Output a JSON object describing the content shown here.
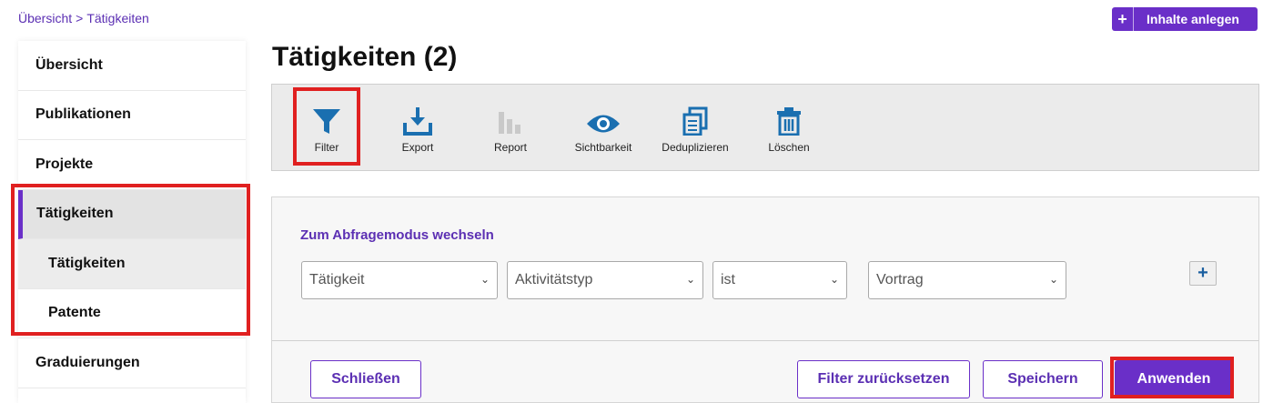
{
  "breadcrumb": {
    "home": "Übersicht",
    "separator": ">",
    "current": "Tätigkeiten"
  },
  "header": {
    "create_label": "Inhalte anlegen",
    "create_plus": "+"
  },
  "sidebar": {
    "items": [
      {
        "label": "Übersicht"
      },
      {
        "label": "Publikationen"
      },
      {
        "label": "Projekte"
      },
      {
        "label": "Tätigkeiten"
      },
      {
        "label": "Tätigkeiten"
      },
      {
        "label": "Patente"
      },
      {
        "label": "Graduierungen"
      }
    ]
  },
  "page": {
    "title": "Tätigkeiten (2)"
  },
  "toolbar": {
    "filter": "Filter",
    "export": "Export",
    "report": "Report",
    "visibility": "Sichtbarkeit",
    "dedupe": "Deduplizieren",
    "delete": "Löschen"
  },
  "filter_panel": {
    "switch_mode": "Zum Abfragemodus wechseln",
    "field1": "Tätigkeit",
    "field2": "Aktivitätstyp",
    "operator": "ist",
    "value": "Vortrag",
    "add_symbol": "+",
    "close": "Schließen",
    "reset": "Filter zurücksetzen",
    "save": "Speichern",
    "apply": "Anwenden"
  },
  "colors": {
    "accent": "#6a2fc8",
    "highlight": "#e02020",
    "icon_blue": "#1a6fb0"
  }
}
